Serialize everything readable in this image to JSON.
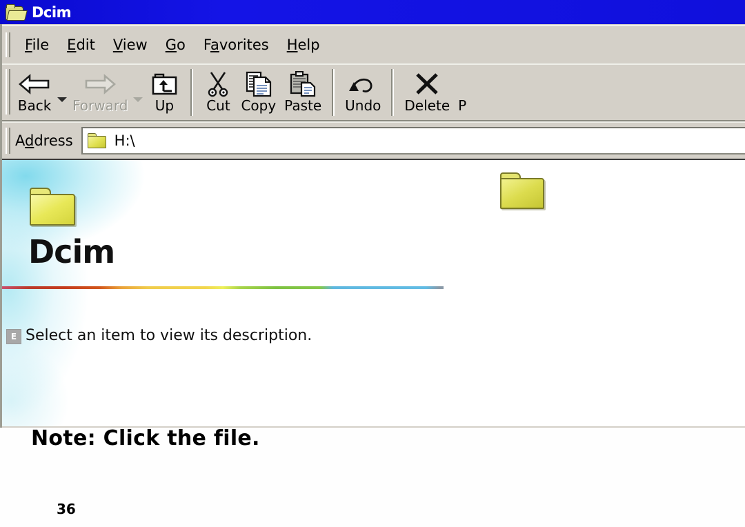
{
  "window": {
    "title": "Dcim",
    "title_icon": "open-folder-icon"
  },
  "menu": {
    "items": [
      {
        "label": "File",
        "accel": "F",
        "before": "",
        "after": "ile"
      },
      {
        "label": "Edit",
        "accel": "E",
        "before": "",
        "after": "dit"
      },
      {
        "label": "View",
        "accel": "V",
        "before": "",
        "after": "iew"
      },
      {
        "label": "Go",
        "accel": "G",
        "before": "",
        "after": "o"
      },
      {
        "label": "Favorites",
        "accel": "a",
        "before": "F",
        "after": "vorites"
      },
      {
        "label": "Help",
        "accel": "H",
        "before": "",
        "after": "elp"
      }
    ]
  },
  "toolbar": {
    "buttons": [
      {
        "label": "Back",
        "icon": "arrow-left-icon",
        "enabled": true,
        "has_dropdown": true
      },
      {
        "label": "Forward",
        "icon": "arrow-right-icon",
        "enabled": false,
        "has_dropdown": true
      },
      {
        "label": "Up",
        "icon": "folder-up-icon",
        "enabled": true,
        "has_dropdown": false
      },
      {
        "label": "Cut",
        "icon": "scissors-icon",
        "enabled": true,
        "has_dropdown": false
      },
      {
        "label": "Copy",
        "icon": "copy-pages-icon",
        "enabled": true,
        "has_dropdown": false
      },
      {
        "label": "Paste",
        "icon": "clipboard-icon",
        "enabled": true,
        "has_dropdown": false
      },
      {
        "label": "Undo",
        "icon": "undo-arrow-icon",
        "enabled": true,
        "has_dropdown": false
      },
      {
        "label": "Delete",
        "icon": "x-cross-icon",
        "enabled": true,
        "has_dropdown": false
      },
      {
        "label": "P",
        "icon": "properties-icon",
        "enabled": true,
        "has_dropdown": false
      }
    ]
  },
  "address": {
    "label": "Address",
    "label_before": "A",
    "label_accel": "d",
    "label_after": "dress",
    "value": "H:\\",
    "icon": "folder-icon"
  },
  "webview": {
    "heading": "Dcim",
    "description": "Select an item to view its description.",
    "description_icon_letter": "E",
    "folder_icon": "folder-icon"
  },
  "file_list": {
    "items": [
      {
        "name": "",
        "icon": "folder-icon"
      }
    ]
  },
  "annotations": {
    "note": "Note: Click the file.",
    "page_number": "36"
  },
  "colors": {
    "titlebar_blue": "#1010dc",
    "window_face": "#d4d0c8",
    "folder_yellow": "#e8e858",
    "watermark_cyan": "#78d7eb",
    "disabled_text": "#9a9a92"
  }
}
